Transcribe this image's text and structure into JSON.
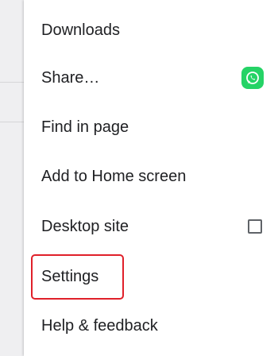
{
  "menu": {
    "items": [
      {
        "label": "Downloads",
        "trailing": "none"
      },
      {
        "label": "Share…",
        "trailing": "whatsapp-icon"
      },
      {
        "label": "Find in page",
        "trailing": "none"
      },
      {
        "label": "Add to Home screen",
        "trailing": "none"
      },
      {
        "label": "Desktop site",
        "trailing": "checkbox",
        "checked": false
      },
      {
        "label": "Settings",
        "trailing": "none",
        "highlighted": true
      },
      {
        "label": "Help & feedback",
        "trailing": "none"
      }
    ]
  },
  "colors": {
    "highlight_border": "#e0202a",
    "whatsapp_green": "#25d366",
    "text": "#202124"
  }
}
